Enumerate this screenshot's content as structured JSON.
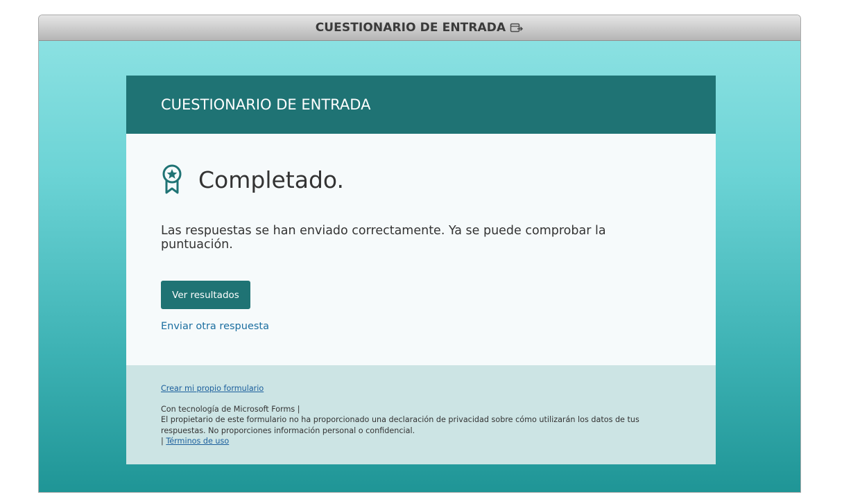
{
  "window": {
    "title": "CUESTIONARIO DE ENTRADA",
    "title_icon": "open-external-icon"
  },
  "form": {
    "header_title": "CUESTIONARIO DE ENTRADA",
    "status_icon": "award-ribbon-icon",
    "status_title": "Completado.",
    "message": "Las respuestas se han enviado correctamente. Ya se puede comprobar la puntuación.",
    "view_results_label": "Ver resultados",
    "another_response_label": "Enviar otra respuesta"
  },
  "footer": {
    "create_form_link": "Crear mi propio formulario",
    "powered_by": "Con tecnología de Microsoft Forms |",
    "privacy_notice": "El propietario de este formulario no ha proporcionado una declaración de privacidad sobre cómo utilizarán los datos de tus respuestas. No proporciones información personal o confidencial.",
    "terms_separator": "|",
    "terms_link": "Términos de uso"
  },
  "colors": {
    "header_bg": "#1f7374",
    "button_bg": "#1f7374",
    "link": "#1b6ea0",
    "footer_bg": "#cce4e4"
  }
}
